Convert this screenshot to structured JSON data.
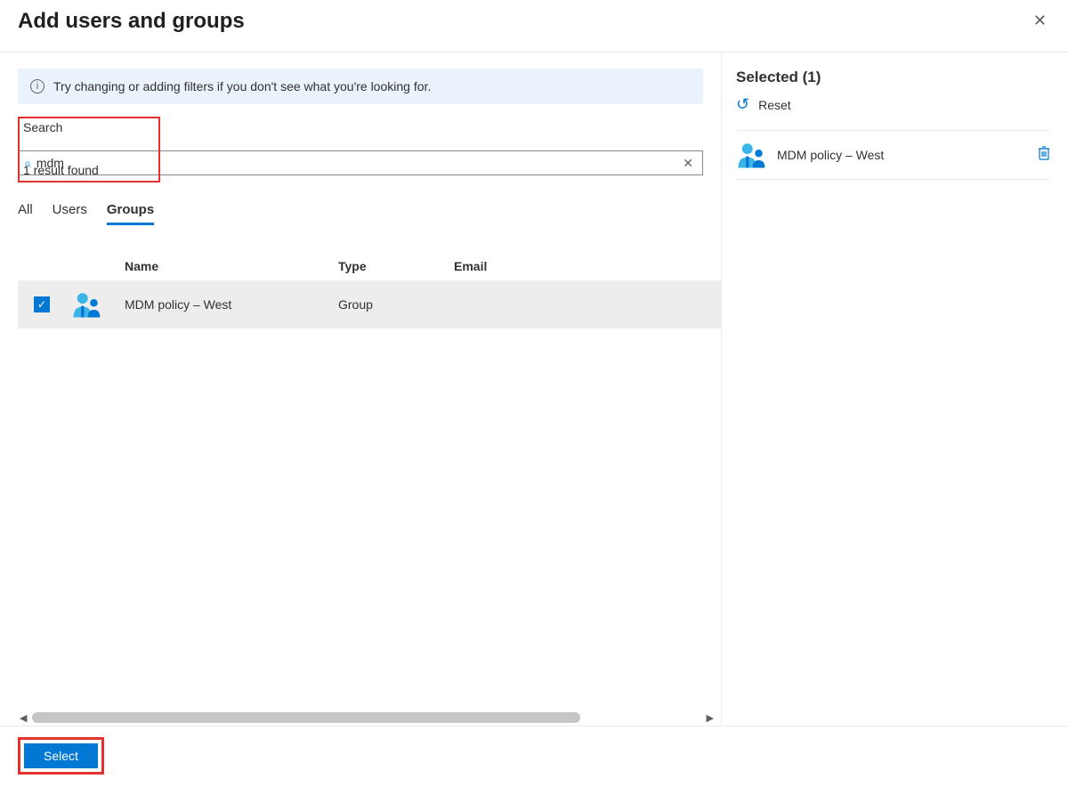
{
  "header": {
    "title": "Add users and groups"
  },
  "banner": {
    "text": "Try changing or adding filters if you don't see what you're looking for."
  },
  "search": {
    "label": "Search",
    "value": "mdm",
    "result_text": "1 result found"
  },
  "tabs": {
    "all": "All",
    "users": "Users",
    "groups": "Groups"
  },
  "columns": {
    "name": "Name",
    "type": "Type",
    "email": "Email"
  },
  "results": {
    "row0": {
      "name": "MDM policy – West",
      "type": "Group",
      "email": ""
    }
  },
  "selected": {
    "title": "Selected (1)",
    "reset": "Reset",
    "item0": {
      "name": "MDM policy – West"
    }
  },
  "footer": {
    "select": "Select"
  }
}
